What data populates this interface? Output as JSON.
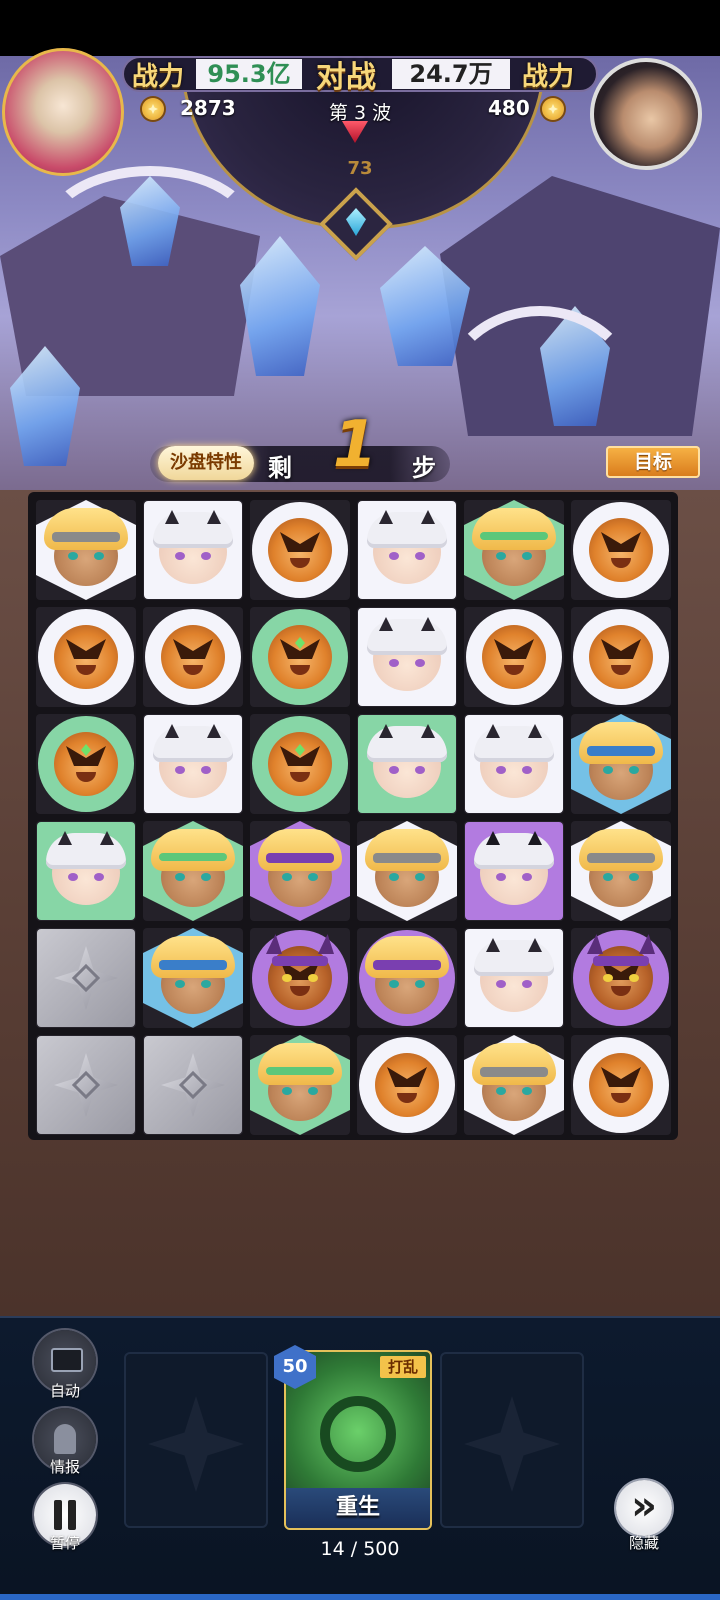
{
  "hud": {
    "left_power_label": "战力",
    "left_power_value": "95.3亿",
    "vs_label": "对战",
    "right_power_value": "24.7万",
    "right_power_label": "战力",
    "left_coins": "2873",
    "wave_label": "第 3 波",
    "right_coins": "480",
    "gem_count": "73"
  },
  "steps": {
    "trait_button": "沙盘特性",
    "remaining_prefix": "剩",
    "remaining_value": "1",
    "remaining_suffix": "步",
    "target_button": "目标"
  },
  "board": {
    "rows": 6,
    "cols": 6,
    "tiles": [
      [
        "white-hex:goldband",
        "white-square:horngirl",
        "white-circle:monkey",
        "white-square:horngirl",
        "green-hex:goldgreen",
        "white-circle:monkey"
      ],
      [
        "white-circle:monkey",
        "white-circle:monkey",
        "green-circle:monkeygem",
        "white-square:horngirl",
        "white-circle:monkey",
        "white-circle:monkey"
      ],
      [
        "green-circle:monkeygem",
        "white-square:horngirl",
        "green-circle:monkeygem",
        "green-square:horngirl",
        "white-square:horngirl",
        "blue-hex:blueband"
      ],
      [
        "green-square:horngirl",
        "green-hex:goldgreen",
        "purple-hex:goldpurple",
        "white-hex:goldband",
        "purple-square:darkhorn",
        "white-hex:goldband"
      ],
      [
        "stone",
        "blue-hex:blueband",
        "purple-circle:dragon",
        "purple-circle:goldpurple",
        "white-square:horngirl",
        "purple-circle:dragon"
      ],
      [
        "stone",
        "stone",
        "green-hex:goldgreen",
        "white-circle:monkey",
        "white-hex:goldband",
        "white-circle:monkey"
      ]
    ]
  },
  "controls": {
    "auto_label": "自动",
    "info_label": "情报",
    "pause_label": "暂停",
    "hide_label": "隐藏"
  },
  "card": {
    "cost": "50",
    "tag": "打乱",
    "name": "重生"
  },
  "progress": "14 / 500",
  "colors": {
    "accent_gold": "#f7d77a",
    "power_green": "#2f8f55",
    "target_orange": "#f0a030",
    "tile_green": "#87d6a6",
    "tile_purple": "#b27be0",
    "tile_blue": "#75c1e6"
  }
}
